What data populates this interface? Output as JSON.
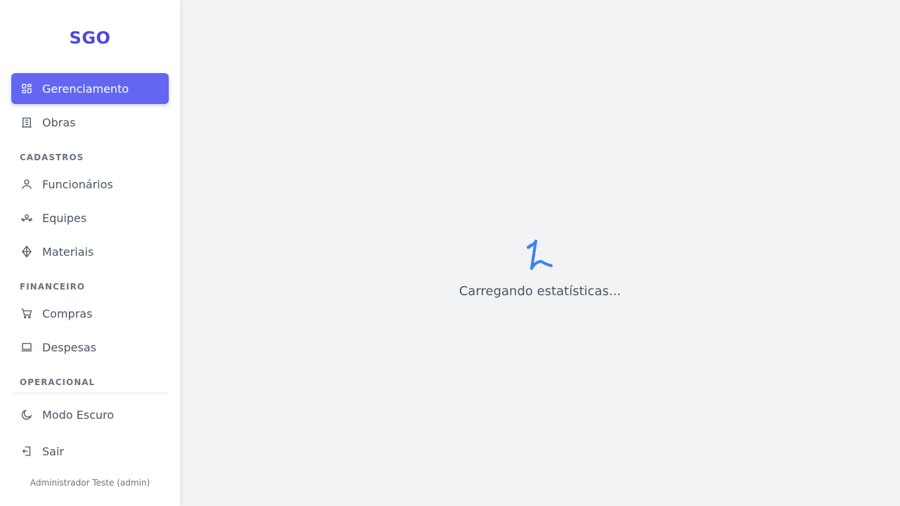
{
  "app": {
    "title": "SGO"
  },
  "nav": {
    "gerenciamento": "Gerenciamento",
    "obras": "Obras",
    "cadastros": "CADASTROS",
    "funcionarios": "Funcionários",
    "equipes": "Equipes",
    "materiais": "Materiais",
    "financeiro": "FINANCEIRO",
    "compras": "Compras",
    "despesas": "Despesas",
    "operacional": "OPERACIONAL",
    "modo_escuro": "Modo Escuro",
    "sair": "Sair"
  },
  "user": {
    "label": "Administrador Teste (admin)"
  },
  "main": {
    "loading_text": "Carregando estatísticas..."
  },
  "icons": {
    "gerenciamento": "dashboard-grid-icon",
    "obras": "building-icon",
    "funcionarios": "user-icon",
    "equipes": "users-icon",
    "materiais": "package-icon",
    "compras": "shopping-cart-icon",
    "despesas": "laptop-icon",
    "modo_escuro": "moon-icon",
    "sair": "logout-icon",
    "loader": "spinner-icon"
  },
  "colors": {
    "brand": "#4f46e5",
    "active_bg": "#6366f1",
    "loader": "#3b82f6",
    "background": "#f2f3f5"
  }
}
